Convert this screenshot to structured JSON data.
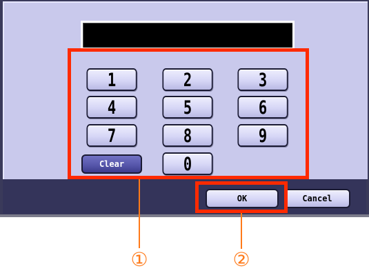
{
  "display": {
    "value": ""
  },
  "keypad": {
    "keys": [
      "1",
      "2",
      "3",
      "4",
      "5",
      "6",
      "7",
      "8",
      "9",
      "0"
    ],
    "clear_label": "Clear"
  },
  "footer": {
    "ok_label": "OK",
    "cancel_label": "Cancel"
  },
  "callouts": {
    "keypad_marker": "①",
    "ok_marker": "②"
  },
  "colors": {
    "panel_bg": "#c9c9ec",
    "bottom_bar": "#34345a",
    "highlight": "#ff2a00",
    "callout": "#ff7a1a",
    "clear_button": "#5454a8"
  }
}
